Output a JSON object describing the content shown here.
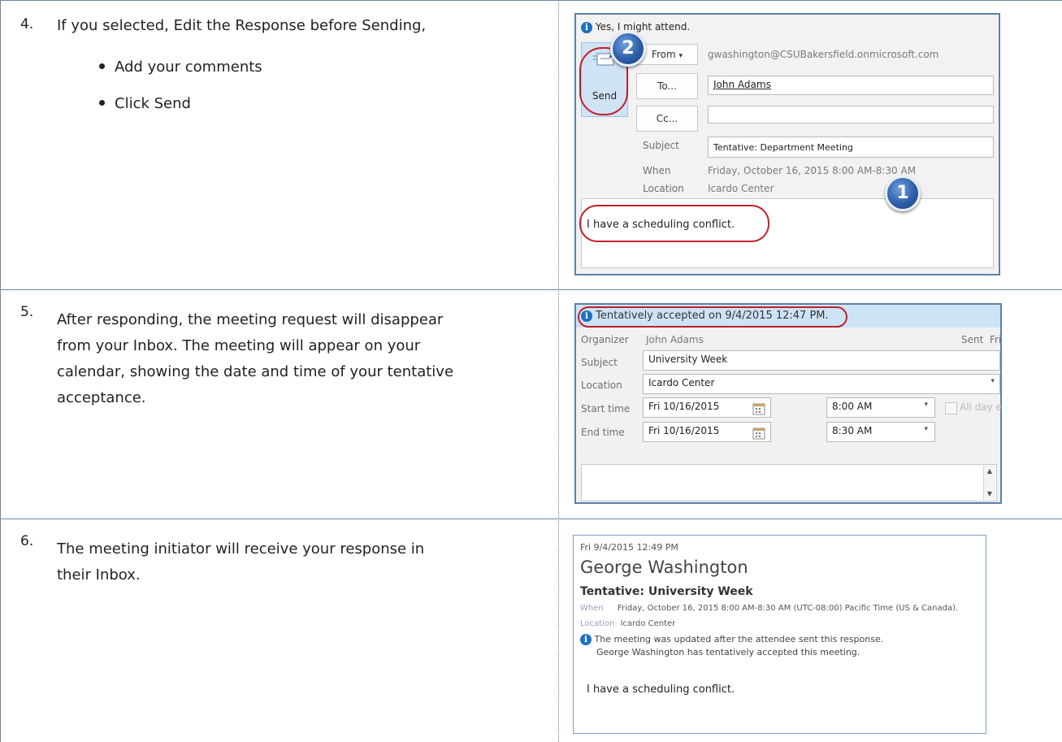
{
  "steps": [
    {
      "number": "4.",
      "text": "If you selected, Edit the Response before Sending,",
      "bullets": [
        "Add your comments",
        "Click Send"
      ]
    },
    {
      "number": "5.",
      "lines": [
        "After responding, the meeting request will disappear",
        "from your Inbox. The meeting will appear on your",
        "calendar, showing the date and time of your tentative",
        "acceptance."
      ]
    },
    {
      "number": "6.",
      "lines": [
        "The meeting initiator will receive your response in",
        "their Inbox."
      ]
    }
  ],
  "response_window": {
    "info": "Yes, I might attend.",
    "send_label": "Send",
    "from_label": "From",
    "from_email": "gwashington@CSUBakersfield.onmicrosoft.com",
    "to_label": "To...",
    "to_value": "John Adams",
    "cc_label": "Cc...",
    "cc_value": "",
    "subject_label": "Subject",
    "subject_value": "Tentative: Department Meeting",
    "when_label": "When",
    "when_value": "Friday, October 16, 2015 8:00 AM-8:30 AM",
    "location_label": "Location",
    "location_value": "Icardo Center",
    "body": "I have a scheduling conflict.",
    "callout_1": "1",
    "callout_2": "2"
  },
  "meeting_window": {
    "info": "Tentatively accepted on 9/4/2015 12:47 PM.",
    "organizer_label": "Organizer",
    "organizer_value": "John Adams",
    "sent_label": "Sent",
    "sent_value": "Fri",
    "subject_label": "Subject",
    "subject_value": "University Week",
    "location_label": "Location",
    "location_value": "Icardo Center",
    "start_label": "Start time",
    "start_date": "Fri 10/16/2015",
    "start_time": "8:00 AM",
    "end_label": "End time",
    "end_date": "Fri 10/16/2015",
    "end_time": "8:30 AM",
    "allday_label": "All day e"
  },
  "reply_window": {
    "timestamp": "Fri 9/4/2015 12:49 PM",
    "sender": "George Washington",
    "subject": "Tentative: University Week",
    "when_label": "When",
    "when_value": "Friday, October 16, 2015 8:00 AM-8:30 AM (UTC-08:00) Pacific Time (US & Canada).",
    "location_label": "Location",
    "location_value": "Icardo Center",
    "info_line1": "The meeting was updated after the attendee sent this response.",
    "info_line2": "George Washington has tentatively accepted this meeting.",
    "body": "I have a scheduling conflict."
  }
}
